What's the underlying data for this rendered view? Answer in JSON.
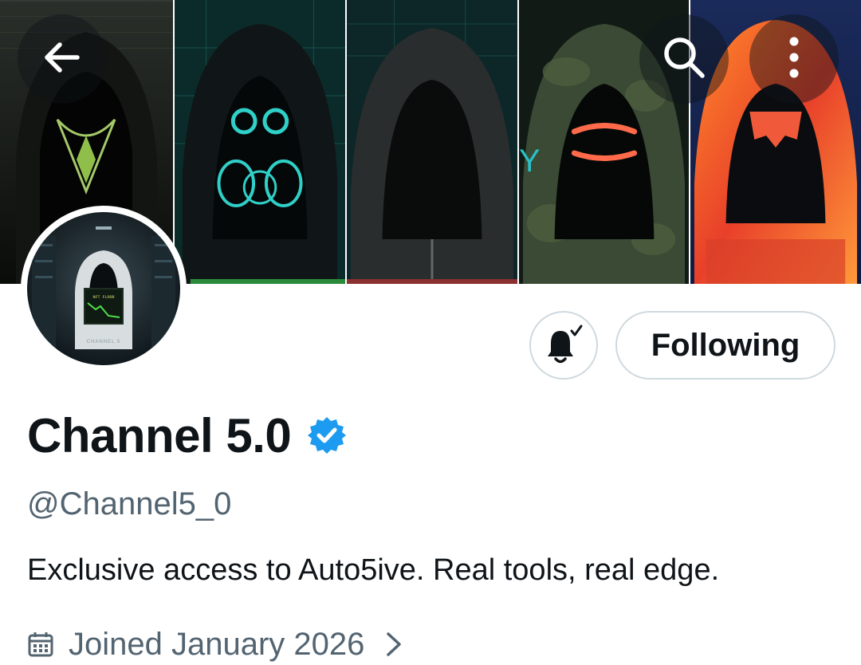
{
  "header": {
    "back_icon": "arrow-left-icon",
    "search_icon": "search-icon",
    "more_icon": "more-vertical-icon"
  },
  "banner": {
    "panels": [
      "green-hooded-figure",
      "gas-mask-hooded-figure",
      "dark-hooded-figure",
      "camo-hooded-figure",
      "orange-hooded-figure"
    ]
  },
  "avatar": {
    "screen_text": "NFT FLOOR",
    "footer_text": "CHANNEL 5"
  },
  "actions": {
    "notification_icon": "bell-check-icon",
    "following_label": "Following"
  },
  "profile": {
    "display_name": "Channel 5.0",
    "verified_icon": "verified-badge-icon",
    "handle": "@Channel5_0",
    "bio": "Exclusive access to Auto5ive. Real tools, real edge.",
    "joined": "Joined January 2026",
    "calendar_icon": "calendar-icon",
    "chevron_icon": "chevron-right-icon"
  },
  "colors": {
    "text_primary": "#0f1419",
    "text_secondary": "#536471",
    "border": "#cfd9de",
    "verified_blue": "#1d9bf0"
  }
}
